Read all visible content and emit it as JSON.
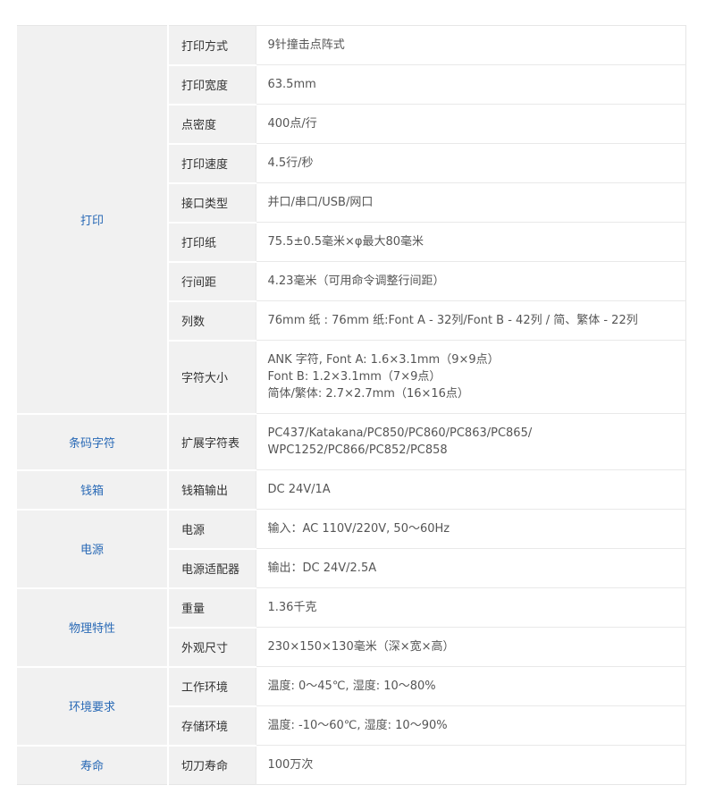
{
  "categories": {
    "print": "打印",
    "barcode": "条码字符",
    "drawer": "钱箱",
    "power": "电源",
    "physical": "物理特性",
    "environment": "环境要求",
    "life": "寿命"
  },
  "rows": [
    {
      "key": "打印方式",
      "lines": [
        "9针撞击点阵式"
      ]
    },
    {
      "key": "打印宽度",
      "lines": [
        "63.5mm"
      ]
    },
    {
      "key": "点密度",
      "lines": [
        "400点/行"
      ]
    },
    {
      "key": "打印速度",
      "lines": [
        "4.5行/秒"
      ]
    },
    {
      "key": "接口类型",
      "lines": [
        "并口/串口/USB/网口"
      ]
    },
    {
      "key": "打印纸",
      "lines": [
        "75.5±0.5毫米×φ最大80毫米"
      ]
    },
    {
      "key": "行间距",
      "lines": [
        "4.23毫米（可用命令调整行间距）"
      ]
    },
    {
      "key": "列数",
      "lines": [
        "76mm 纸 : 76mm 纸:Font A - 32列/Font B - 42列 / 简、繁体 - 22列"
      ]
    },
    {
      "key": "字符大小",
      "lines": [
        "ANK 字符, Font A: 1.6×3.1mm（9×9点）",
        "Font B: 1.2×3.1mm（7×9点）",
        "简体/繁体: 2.7×2.7mm（16×16点）"
      ]
    },
    {
      "key": "扩展字符表",
      "lines": [
        "PC437/Katakana/PC850/PC860/PC863/PC865/",
        "WPC1252/PC866/PC852/PC858"
      ]
    },
    {
      "key": "钱箱输出",
      "lines": [
        "DC 24V/1A"
      ]
    },
    {
      "key": "电源",
      "lines": [
        "输入：AC 110V/220V, 50～60Hz"
      ]
    },
    {
      "key": "电源适配器",
      "lines": [
        "输出：DC 24V/2.5A"
      ]
    },
    {
      "key": "重量",
      "lines": [
        "1.36千克"
      ]
    },
    {
      "key": "外观尺寸",
      "lines": [
        "230×150×130毫米（深×宽×高）"
      ]
    },
    {
      "key": "工作环境",
      "lines": [
        "温度: 0～45℃, 湿度: 10～80%"
      ]
    },
    {
      "key": "存储环境",
      "lines": [
        "温度: -10～60℃, 湿度: 10～90%"
      ]
    },
    {
      "key": "切刀寿命",
      "lines": [
        "100万次"
      ]
    }
  ]
}
